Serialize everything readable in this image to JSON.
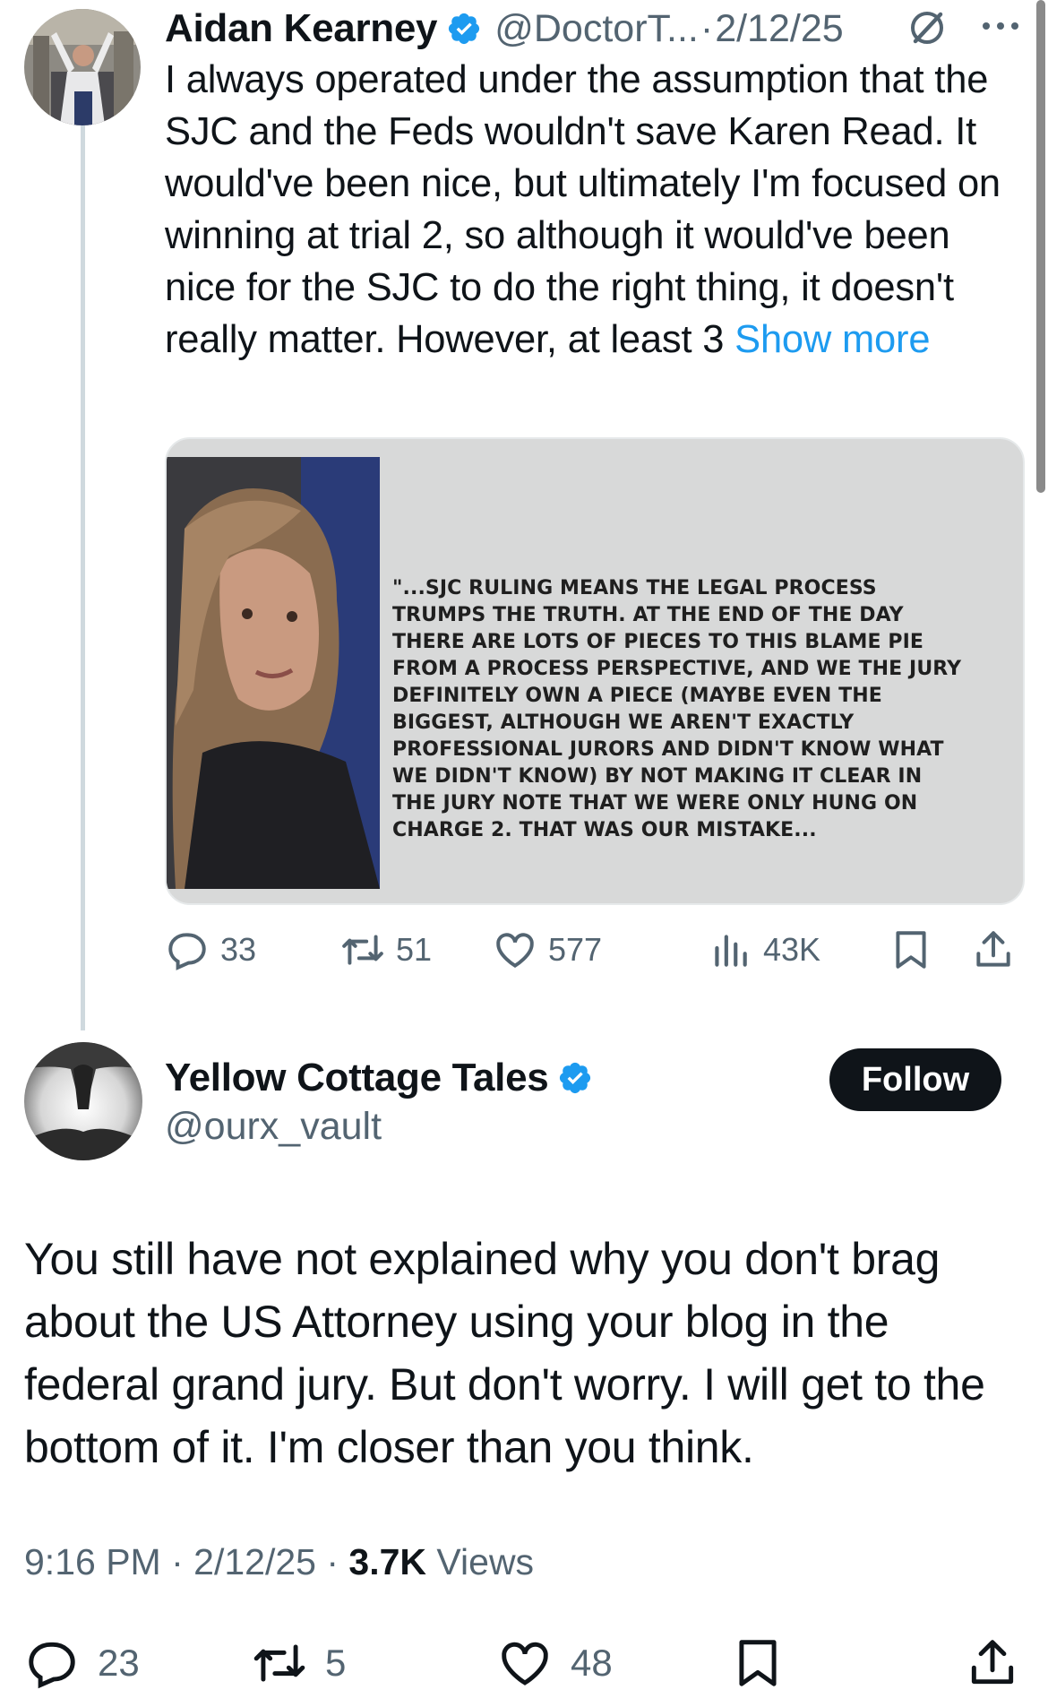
{
  "colors": {
    "accent": "#1d9bf0",
    "text": "#0f1419",
    "muted": "#536471",
    "follow_bg": "#0f1419"
  },
  "parent_tweet": {
    "author_name": "Aidan Kearney",
    "handle": "@DoctorT...",
    "separator": "·",
    "date": "2/12/25",
    "text": "I always operated under the assumption that the SJC and the Feds wouldn't save Karen Read. It would've been nice, but ultimately I'm focused on winning at trial 2, so although it would've been nice for the SJC to do the right thing, it doesn't really matter. However, at least 3 ",
    "show_more": "Show more",
    "media_quote": "\"...SJC RULING MEANS THE LEGAL PROCESS TRUMPS THE TRUTH. AT THE END OF THE DAY THERE ARE LOTS OF PIECES TO THIS BLAME PIE FROM A PROCESS PERSPECTIVE, AND WE THE JURY DEFINITELY OWN A PIECE (MAYBE EVEN THE BIGGEST, ALTHOUGH WE AREN'T EXACTLY PROFESSIONAL JURORS AND DIDN'T KNOW WHAT WE DIDN'T KNOW) BY NOT MAKING IT CLEAR IN THE JURY NOTE THAT WE WERE ONLY HUNG ON CHARGE 2. THAT WAS OUR MISTAKE...",
    "stats": {
      "replies": "33",
      "reposts": "51",
      "likes": "577",
      "views": "43K"
    }
  },
  "reply_tweet": {
    "author_name": "Yellow Cottage Tales",
    "handle": "@ourx_vault",
    "follow_label": "Follow",
    "text": "You still have not explained why you don't brag about the US Attorney using your blog in the federal grand jury. But don't worry. I will get to the bottom of it. I'm closer than you think.",
    "time": "9:16 PM",
    "date": "2/12/25",
    "views_count": "3.7K",
    "views_label": "Views",
    "stats": {
      "replies": "23",
      "reposts": "5",
      "likes": "48"
    }
  },
  "icons": [
    "verified-badge-icon",
    "grok-icon",
    "more-icon",
    "reply-icon",
    "repost-icon",
    "like-icon",
    "views-icon",
    "bookmark-icon",
    "share-icon"
  ]
}
